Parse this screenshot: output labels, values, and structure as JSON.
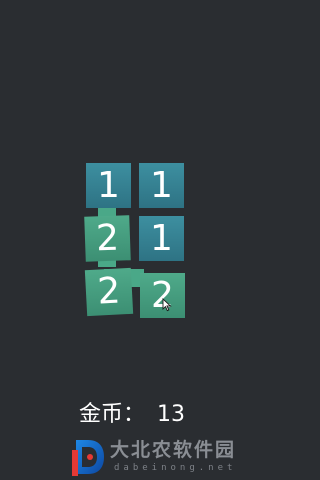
{
  "board": {
    "tiles": [
      {
        "value": "1",
        "color": "#3d8fa0"
      },
      {
        "value": "1",
        "color": "#3d8fa0"
      },
      {
        "value": "2",
        "color": "#4faa8a"
      },
      {
        "value": "1",
        "color": "#3d8fa0"
      },
      {
        "value": "2",
        "color": "#4faa8a"
      },
      {
        "value": "2",
        "color": "#4faa8a"
      }
    ],
    "link_color": "#4aa888"
  },
  "coins": {
    "label": "金币：",
    "value": "13"
  },
  "watermark": {
    "name": "大北农软件园",
    "url": "dabeinong.net",
    "logo_letter": "D"
  },
  "colors": {
    "background": "#2a2d31",
    "tile_blue": "#3d8fa0",
    "tile_green": "#4faa8a",
    "text": "#ffffff"
  }
}
